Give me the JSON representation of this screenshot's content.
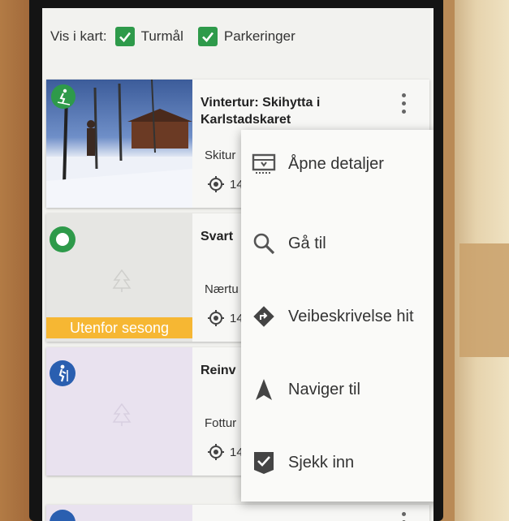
{
  "filter": {
    "label": "Vis i kart:",
    "options": [
      {
        "label": "Turmål",
        "checked": true
      },
      {
        "label": "Parkeringer",
        "checked": true
      }
    ]
  },
  "cards": [
    {
      "title": "Vintertur: Skihytta i Karlstadskaret",
      "subtitle": "Skitur",
      "distance": "14",
      "category_icon": "skiing-icon",
      "category_color": "#2e9a4a"
    },
    {
      "title": "Svart",
      "subtitle": "Nærtu",
      "distance": "14",
      "category_icon": "ring-icon",
      "category_color": "#2e9a4a",
      "badge": "Utenfor sesong"
    },
    {
      "title": "Reinv",
      "subtitle": "Fottur",
      "distance": "14",
      "category_icon": "hiking-icon",
      "category_color": "#2a5fb0"
    }
  ],
  "menu": {
    "items": [
      {
        "label": "Åpne detaljer",
        "icon": "open-details-icon"
      },
      {
        "label": "Gå til",
        "icon": "search-icon"
      },
      {
        "label": "Veibeskrivelse hit",
        "icon": "directions-icon"
      },
      {
        "label": "Naviger til",
        "icon": "navigate-icon"
      },
      {
        "label": "Sjekk inn",
        "icon": "check-in-icon"
      }
    ]
  },
  "colors": {
    "accent_green": "#2e9a4a",
    "badge_yellow": "#f6b733",
    "hiking_blue": "#2a5fb0"
  }
}
